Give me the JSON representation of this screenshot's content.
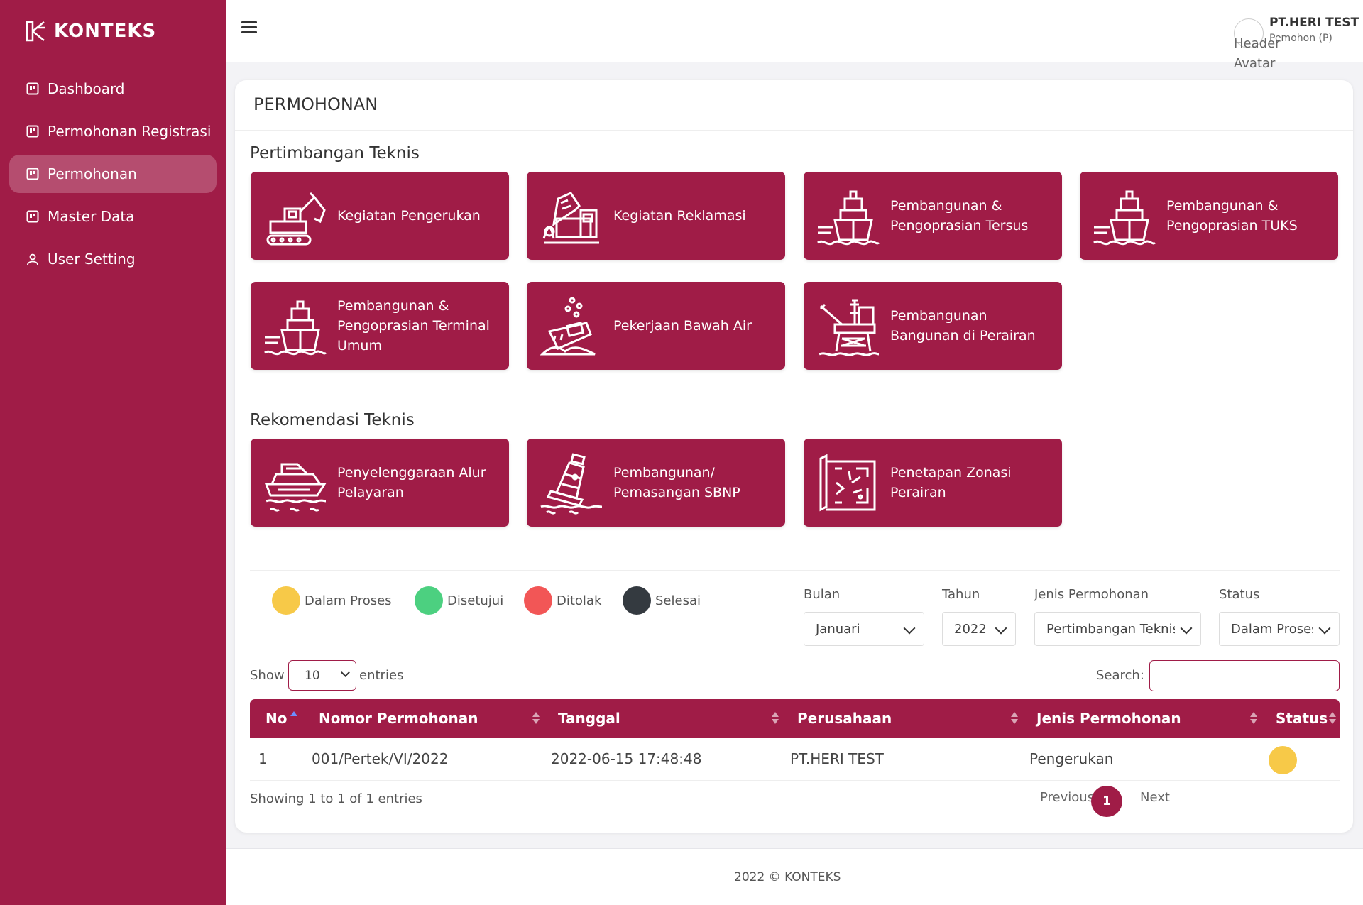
{
  "brand": {
    "name": "KONTEKS"
  },
  "sidebar": {
    "items": [
      {
        "label": "Dashboard",
        "icon": "dashboard-icon"
      },
      {
        "label": "Permohonan Registrasi",
        "icon": "dashboard-icon"
      },
      {
        "label": "Permohonan",
        "icon": "dashboard-icon",
        "active": true
      },
      {
        "label": "Master Data",
        "icon": "dashboard-icon"
      },
      {
        "label": "User Setting",
        "icon": "user-icon"
      }
    ]
  },
  "header": {
    "avatar_alt": "Header Avatar",
    "user_name": "PT.HERI TEST",
    "user_role": "Pemohon (P)"
  },
  "page": {
    "title": "PERMOHONAN",
    "section1_title": "Pertimbangan Teknis",
    "section2_title": "Rekomendasi Teknis",
    "tiles": [
      {
        "label": "Kegiatan Pengerukan",
        "icon": "excavator-icon"
      },
      {
        "label": "Kegiatan Reklamasi",
        "icon": "dump-truck-icon"
      },
      {
        "label": "Pembangunan & Pengoprasian Tersus",
        "icon": "ship-icon"
      },
      {
        "label": "Pembangunan & Pengoprasian TUKS",
        "icon": "ship-icon"
      },
      {
        "label": "Pembangunan & Pengoprasian Terminal Umum",
        "icon": "ship-icon"
      },
      {
        "label": "Pekerjaan Bawah Air",
        "icon": "shipwreck-icon"
      },
      {
        "label": "Pembangunan Bangunan di Perairan",
        "icon": "oil-rig-icon"
      },
      {
        "label": "Penyelenggaraan Alur Pelayaran",
        "icon": "yacht-icon"
      },
      {
        "label": "Pembangunan/ Pemasangan SBNP",
        "icon": "buoy-icon"
      },
      {
        "label": "Penetapan Zonasi Perairan",
        "icon": "map-icon"
      }
    ]
  },
  "legend": [
    {
      "label": "Dalam Proses",
      "color": "#f7c948"
    },
    {
      "label": "Disetujui",
      "color": "#4cd080"
    },
    {
      "label": "Ditolak",
      "color": "#f25656"
    },
    {
      "label": "Selesai",
      "color": "#343a40"
    }
  ],
  "filters": {
    "bulan_label": "Bulan",
    "bulan_value": "Januari",
    "tahun_label": "Tahun",
    "tahun_value": "2022",
    "jenis_label": "Jenis Permohonan",
    "jenis_value": "Pertimbangan Teknis",
    "status_label": "Status",
    "status_value": "Dalam Proses"
  },
  "datatable": {
    "show_label": "Show",
    "entries_label": "entries",
    "entries_value": "10",
    "search_label": "Search:",
    "columns": [
      "No",
      "Nomor Permohonan",
      "Tanggal",
      "Perusahaan",
      "Jenis Permohonan",
      "Status"
    ],
    "rows": [
      {
        "no": "1",
        "nomor": "001/Pertek/VI/2022",
        "tanggal": "2022-06-15 17:48:48",
        "perusahaan": "PT.HERI TEST",
        "jenis": "Pengerukan",
        "status_color": "#f7c948"
      }
    ],
    "info": "Showing 1 to 1 of 1 entries",
    "previous": "Previous",
    "page": "1",
    "next": "Next"
  },
  "footer": {
    "text": "2022 © KONTEKS"
  },
  "colors": {
    "primary": "#a01c47",
    "accent_sort": "#6d8cff"
  }
}
